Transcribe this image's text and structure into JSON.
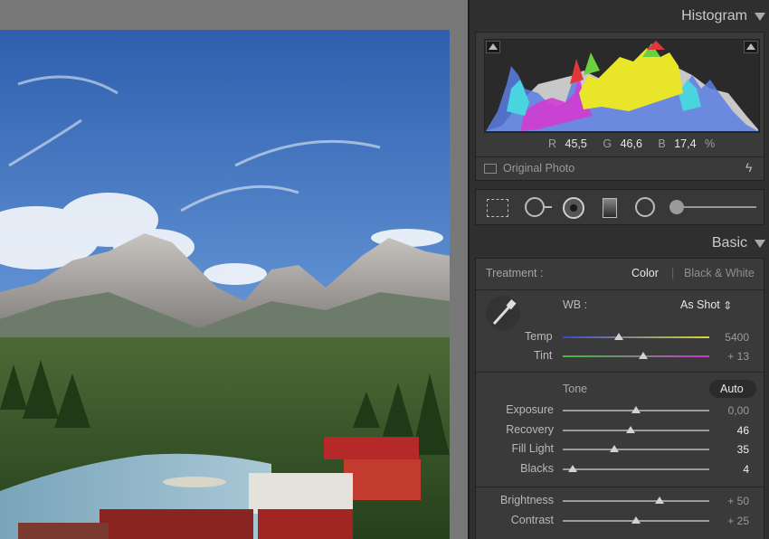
{
  "panels": {
    "histogram_title": "Histogram",
    "basic_title": "Basic"
  },
  "histogram": {
    "r_label": "R",
    "r_value": "45,5",
    "g_label": "G",
    "g_value": "46,6",
    "b_label": "B",
    "b_value": "17,4",
    "unit": "%",
    "original_photo_label": "Original Photo"
  },
  "tools": [
    "crop-overlay-icon",
    "spot-removal-icon",
    "red-eye-icon",
    "graduated-filter-icon",
    "radial-filter-icon",
    "adjustment-brush-icon"
  ],
  "treatment": {
    "label": "Treatment :",
    "option_color": "Color",
    "option_bw": "Black & White"
  },
  "wb": {
    "label": "WB :",
    "value": "As Shot",
    "arrows": "⇕"
  },
  "sliders_wb": [
    {
      "label": "Temp",
      "value": "5400",
      "level": 0.38
    },
    {
      "label": "Tint",
      "value": "+ 13",
      "level": 0.55
    }
  ],
  "tone": {
    "label": "Tone",
    "auto_label": "Auto"
  },
  "sliders_tone": [
    {
      "label": "Exposure",
      "value": "0,00",
      "level": 0.5,
      "active": false
    },
    {
      "label": "Recovery",
      "value": "46",
      "level": 0.46,
      "active": true
    },
    {
      "label": "Fill Light",
      "value": "35",
      "level": 0.35,
      "active": true
    },
    {
      "label": "Blacks",
      "value": "4",
      "level": 0.07,
      "active": true
    }
  ],
  "sliders_presence": [
    {
      "label": "Brightness",
      "value": "+ 50",
      "level": 0.66
    },
    {
      "label": "Contrast",
      "value": "+ 25",
      "level": 0.5
    }
  ]
}
